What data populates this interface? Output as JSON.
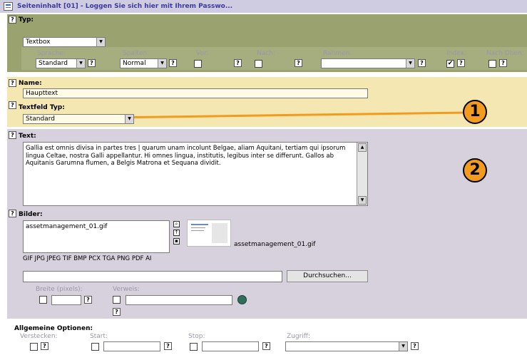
{
  "title_bar": {
    "title": "Seiteninhalt [01] - Loggen Sie sich hier mit Ihrem Passwo..."
  },
  "help_glyph": "?",
  "typ_section": {
    "label": "Typ:",
    "type_value": "Textbox",
    "columns": {
      "sprache": "Sprache:",
      "spalten": "Spalten:",
      "vor": "Vor:",
      "nach": "Nach:",
      "rahmen": "Rahmen:",
      "index": "Index:",
      "nach_oben": "Nach Oben:"
    },
    "sprache_value": "Standard",
    "spalten_value": "Normal",
    "rahmen_value": "",
    "index_checked": true,
    "nach_oben_checked": false
  },
  "name_section": {
    "name_label": "Name:",
    "name_value": "Haupttext",
    "textfeld_label": "Textfeld Typ:",
    "textfeld_value": "Standard"
  },
  "text_section": {
    "label": "Text:",
    "content": "Gallia est omnis divisa in partes tres | quarum unam incolunt Belgae, aliam Aquitani, tertiam qui ipsorum lingua Celtae, nostra Galli appellantur. Hi omnes lingua, institutis, legibus inter se differunt. Gallos ab Aquitanis Garumna flumen, a Belgis Matrona et Sequana dividit."
  },
  "bilder_section": {
    "label": "Bilder:",
    "file_list_item": "assetmanagement_01.gif",
    "thumbnail_caption": "assetmanagement_01.gif",
    "allowed_types": "GIF JPG JPEG TIF BMP PCX TGA PNG PDF AI",
    "browse_button": "Durchsuchen...",
    "breite_label": "Breite (pixels):",
    "verweis_label": "Verweis:"
  },
  "allgemeine_section": {
    "label": "Allgemeine Optionen:",
    "verstecken_label": "Verstecken:",
    "start_label": "Start:",
    "stop_label": "Stop:",
    "zugriff_label": "Zugriff:",
    "zugriff_value": ""
  },
  "callouts": {
    "one": "1",
    "two": "2"
  },
  "colors": {
    "title_bg": "#cfcbe1",
    "typ_bg": "#9aa36f",
    "name_bg": "#f4e7b2",
    "content_bg": "#d6d1dc",
    "callout": "#f39b1f"
  }
}
